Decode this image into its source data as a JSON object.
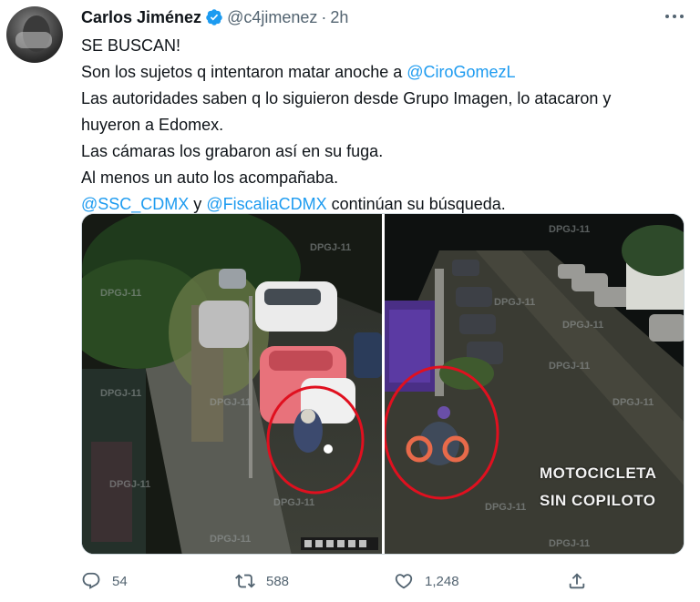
{
  "author": {
    "display_name": "Carlos Jiménez",
    "handle": "@c4jimenez",
    "separator": "·",
    "time": "2h",
    "verified": true,
    "avatar": "profile-photo"
  },
  "tweet": {
    "lines": [
      [
        {
          "text": "SE BUSCAN!"
        }
      ],
      [
        {
          "text": "Son los sujetos q intentaron matar anoche a "
        },
        {
          "text": "@CiroGomezL",
          "mention": true
        }
      ],
      [
        {
          "text": "Las autoridades saben q lo siguieron desde Grupo Imagen, lo atacaron y"
        }
      ],
      [
        {
          "text": "huyeron a Edomex."
        }
      ],
      [
        {
          "text": "Las cámaras los grabaron así en su fuga."
        }
      ],
      [
        {
          "text": "Al menos un auto los acompañaba."
        }
      ],
      [
        {
          "text": "@SSC_CDMX",
          "mention": true
        },
        {
          "text": " y "
        },
        {
          "text": "@FiscaliaCDMX",
          "mention": true
        },
        {
          "text": " continúan su búsqueda."
        }
      ]
    ]
  },
  "media": {
    "left_description": "cctv-street-night-motorcycle-circled",
    "right_description": "cctv-street-night-motorcycle-circled",
    "watermark": "DPGJ-11",
    "caption_line_1": "MOTOCICLETA",
    "caption_line_2": "SIN COPILOTO"
  },
  "actions": {
    "reply_count": "54",
    "retweet_count": "588",
    "like_count": "1,248",
    "icons": [
      "reply-icon",
      "retweet-icon",
      "like-icon",
      "share-icon"
    ]
  },
  "colors": {
    "accent": "#1d9bf0",
    "secondary_text": "#536471",
    "circle_red": "#e0101f"
  }
}
